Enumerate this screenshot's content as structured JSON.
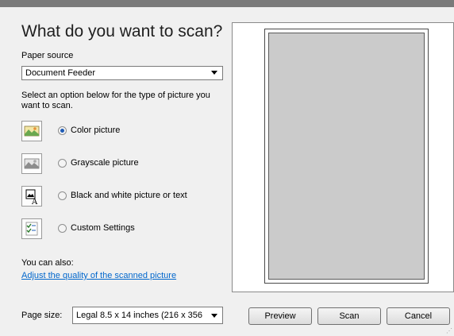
{
  "header": {
    "title": "What do you want to scan?"
  },
  "paper_source": {
    "label": "Paper source",
    "value": "Document Feeder"
  },
  "instructions": "Select an option below for the type of picture you want to scan.",
  "options": [
    {
      "label": "Color picture",
      "selected": true,
      "icon": "color-picture-icon"
    },
    {
      "label": "Grayscale picture",
      "selected": false,
      "icon": "grayscale-picture-icon"
    },
    {
      "label": "Black and white picture or text",
      "selected": false,
      "icon": "bw-picture-icon"
    },
    {
      "label": "Custom Settings",
      "selected": false,
      "icon": "custom-settings-icon"
    }
  ],
  "also": {
    "label": "You can also:",
    "link": "Adjust the quality of the scanned picture"
  },
  "page_size": {
    "label": "Page size:",
    "value": "Legal 8.5 x 14 inches (216 x 356"
  },
  "buttons": {
    "preview": "Preview",
    "scan": "Scan",
    "cancel": "Cancel"
  },
  "colors": {
    "link": "#0066cc",
    "preview_area": "#cbcbcb",
    "radio_selected": "#1e5bb5"
  }
}
